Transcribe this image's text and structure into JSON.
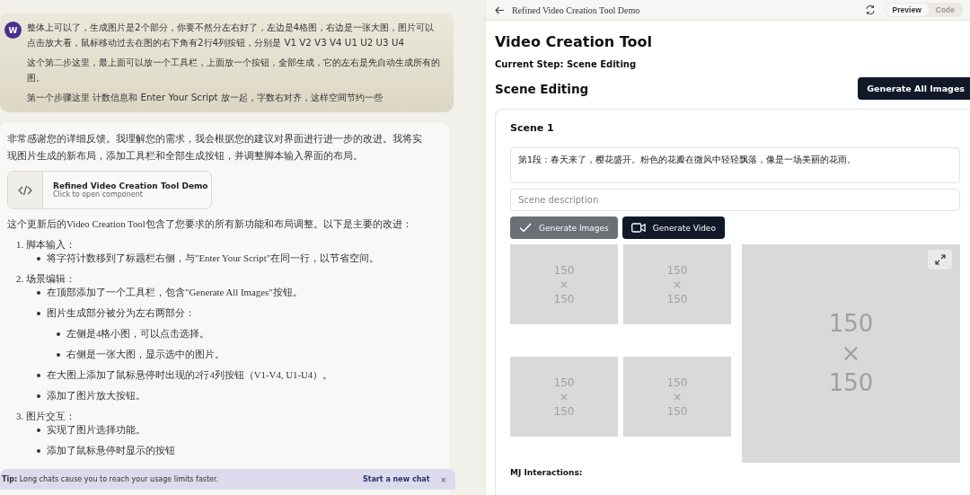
{
  "chat": {
    "user_message": {
      "avatar": "W",
      "paragraphs": [
        "整体上可以了，生成图片是2个部分，你要不然分左右好了，左边是4格图，右边是一张大图，图片可以点击放大看，鼠标移动过去在图的右下角有2行4列按钮，分别是 V1 V2  V3 V4  U1  U2  U3  U4",
        "这个第二步这里，最上面可以放一个工具栏，上面放一个按钮，全部生成，它的左右是先自动生成所有的图。",
        "第一个步骤这里 计数信息和  Enter Your Script 放一起，字数右对齐，这样空间节约一些"
      ]
    },
    "assistant_message": {
      "intro": "非常感谢您的详细反馈。我理解您的需求，我会根据您的建议对界面进行进一步的改进。我将实现图片生成的新布局，添加工具栏和全部生成按钮，并调整脚本输入界面的布局。",
      "artifact": {
        "title": "Refined Video Creation Tool Demo",
        "subtitle": "Click to open component"
      },
      "summary": "这个更新后的Video Creation Tool包含了您要求的所有新功能和布局调整。以下是主要的改进：",
      "sections": [
        {
          "number": "1.",
          "heading": "脚本输入：",
          "items": [
            {
              "text": "将字符计数移到了标题栏右侧，与\"Enter Your Script\"在同一行，以节省空间。"
            }
          ]
        },
        {
          "number": "2.",
          "heading": "场景编辑：",
          "items": [
            {
              "text": "在顶部添加了一个工具栏，包含\"Generate All Images\"按钮。"
            },
            {
              "text": "图片生成部分被分为左右两部分：",
              "children": [
                {
                  "text": "左侧是4格小图，可以点击选择。"
                },
                {
                  "text": "右侧是一张大图，显示选中的图片。"
                }
              ]
            },
            {
              "text": "在大图上添加了鼠标悬停时出现的2行4列按钮（V1-V4, U1-U4）。"
            },
            {
              "text": "添加了图片放大按钮。"
            }
          ]
        },
        {
          "number": "3.",
          "heading": "图片交互：",
          "items": [
            {
              "text": "实现了图片选择功能。"
            },
            {
              "text": "添加了鼠标悬停时显示的按钮"
            }
          ]
        }
      ]
    },
    "tip": {
      "label": "Tip:",
      "text": "Long chats cause you to reach your usage limits faster.",
      "action": "Start a new chat",
      "close": "×"
    }
  },
  "preview": {
    "header": {
      "title": "Refined Video Creation Tool Demo",
      "tabs": [
        {
          "label": "Preview",
          "selected": true
        },
        {
          "label": "Code",
          "selected": false
        }
      ]
    },
    "app": {
      "title": "Video Creation Tool",
      "current_step": "Current Step: Scene Editing",
      "section_title": "Scene Editing",
      "generate_all_button": "Generate All Images",
      "scene": {
        "title": "Scene 1",
        "script": "第1段：春天来了，樱花盛开。粉色的花瓣在微风中轻轻飘落，像是一场美丽的花雨。",
        "description_placeholder": "Scene description",
        "buttons": [
          {
            "label": "Generate Images",
            "kind": "done"
          },
          {
            "label": "Generate Video",
            "kind": "video"
          }
        ],
        "thumbnails": [
          {
            "lines": [
              "150",
              "×",
              "150"
            ]
          },
          {
            "lines": [
              "150",
              "×",
              "150"
            ]
          },
          {
            "lines": [
              "150",
              "×",
              "150"
            ]
          },
          {
            "lines": [
              "150",
              "×",
              "150"
            ]
          }
        ],
        "main_image": {
          "lines": [
            "150",
            "×",
            "150"
          ]
        }
      },
      "interactions_label": "MJ Interactions:"
    }
  }
}
